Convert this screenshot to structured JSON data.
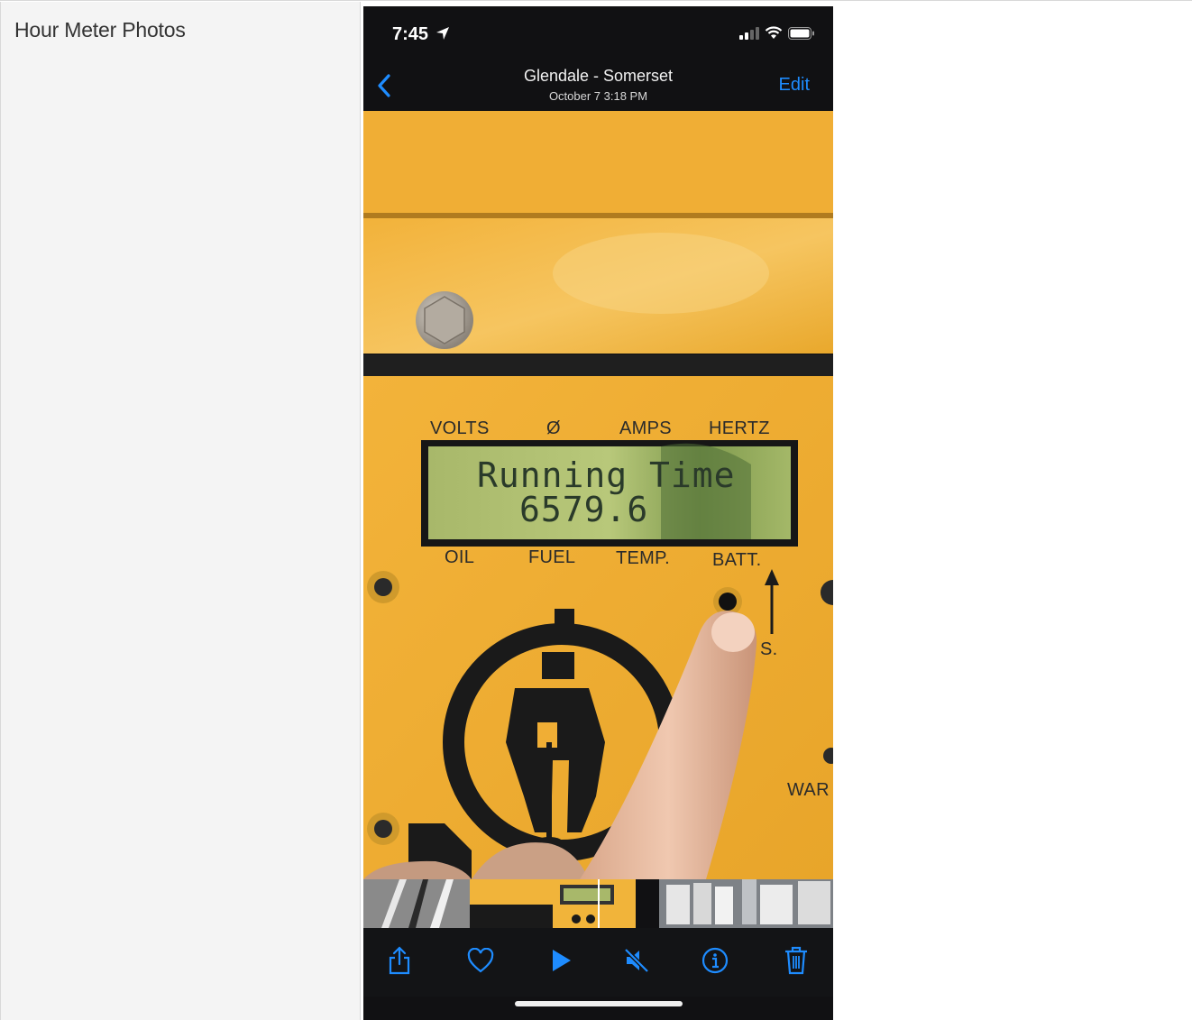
{
  "field": {
    "label": "Hour Meter Photos"
  },
  "phone": {
    "status_time": "7:45",
    "nav_title": "Glendale - Somerset",
    "nav_subtitle": "October 7  3:18 PM",
    "edit_label": "Edit",
    "accent_color": "#1e8cff"
  },
  "photo": {
    "panel_top_labels": [
      "VOLTS",
      "Ø",
      "AMPS",
      "HERTZ"
    ],
    "panel_bottom_labels": [
      "OIL",
      "FUEL",
      "TEMP.",
      "BATT."
    ],
    "lcd_line1": "Running Time",
    "lcd_line2": "6579.6",
    "side_label": "WAR",
    "button_label_fragment": "S."
  },
  "toolbar": {
    "icons": [
      "share-icon",
      "heart-icon",
      "play-icon",
      "mute-icon",
      "info-icon",
      "trash-icon"
    ]
  }
}
